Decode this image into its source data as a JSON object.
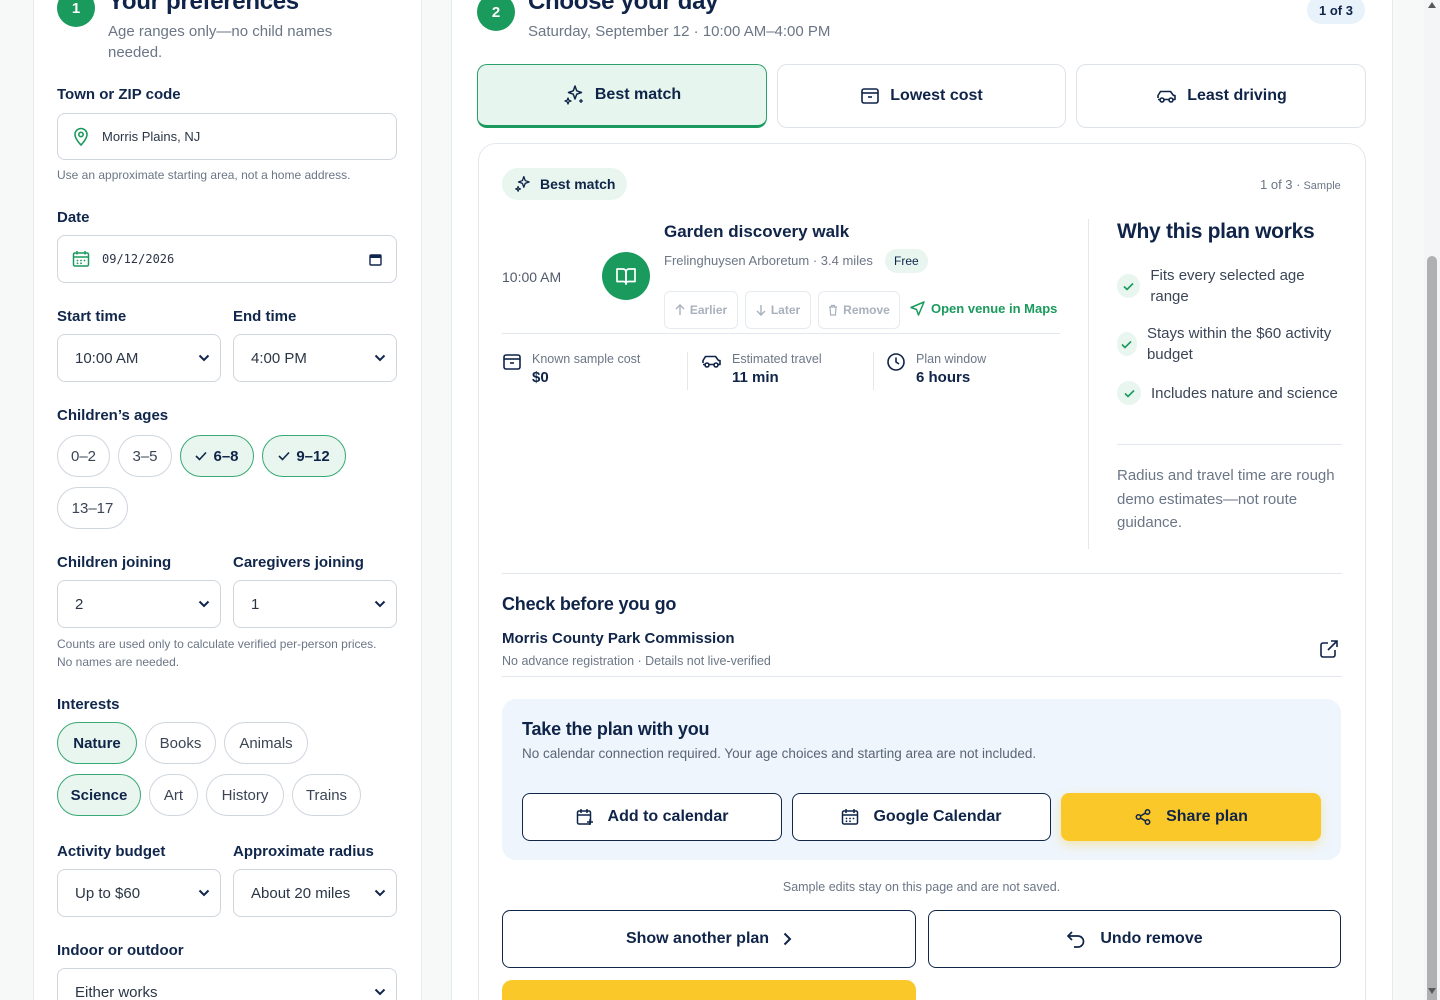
{
  "left": {
    "step_number": "1",
    "title": "Your preferences",
    "subtitle": "Age ranges only—no child names needed.",
    "town_label": "Town or ZIP code",
    "town_value": "Morris Plains, NJ",
    "town_help": "Use an approximate starting area, not a home address.",
    "date_label": "Date",
    "date_value": "09/12/2026",
    "start_label": "Start time",
    "start_value": "10:00 AM",
    "end_label": "End time",
    "end_value": "4:00 PM",
    "ages_label": "Children’s ages",
    "ages": [
      {
        "label": "0–2",
        "selected": false
      },
      {
        "label": "3–5",
        "selected": false
      },
      {
        "label": "6–8",
        "selected": true
      },
      {
        "label": "9–12",
        "selected": true
      },
      {
        "label": "13–17",
        "selected": false
      }
    ],
    "children_label": "Children joining",
    "children_value": "2",
    "caregivers_label": "Caregivers joining",
    "caregivers_value": "1",
    "counts_help": "Counts are used only to calculate verified per-person prices. No names are needed.",
    "interests_label": "Interests",
    "interests": [
      {
        "label": "Nature",
        "selected": true
      },
      {
        "label": "Books",
        "selected": false
      },
      {
        "label": "Animals",
        "selected": false
      },
      {
        "label": "Science",
        "selected": true
      },
      {
        "label": "Art",
        "selected": false
      },
      {
        "label": "History",
        "selected": false
      },
      {
        "label": "Trains",
        "selected": false
      }
    ],
    "budget_label": "Activity budget",
    "budget_value": "Up to $60",
    "radius_label": "Approximate radius",
    "radius_value": "About 20 miles",
    "indoor_label": "Indoor or outdoor",
    "indoor_value": "Either works"
  },
  "right": {
    "step_number": "2",
    "title": "Choose your day",
    "subtitle": "Saturday, September 12 · 10:00 AM–4:00 PM",
    "badge": "1 of 3",
    "tabs": [
      {
        "label": "Best match",
        "icon": "sparkles-icon",
        "active": true
      },
      {
        "label": "Lowest cost",
        "icon": "wallet-icon",
        "active": false
      },
      {
        "label": "Least driving",
        "icon": "car-icon",
        "active": false
      }
    ],
    "card": {
      "pill": "Best match",
      "count": "1 of 3 ·",
      "sample": "Sample",
      "activity": {
        "time": "10:00 AM",
        "title": "Garden discovery walk",
        "meta": "Frelinghuysen Arboretum · 3.4 miles",
        "badge": "Free",
        "earlier": "Earlier",
        "later": "Later",
        "remove": "Remove",
        "maps": "Open venue in Maps"
      },
      "stats": [
        {
          "label": "Known sample cost",
          "value": "$0"
        },
        {
          "label": "Estimated travel",
          "value": "11 min"
        },
        {
          "label": "Plan window",
          "value": "6 hours"
        }
      ],
      "why_title": "Why this plan works",
      "why_items": [
        "Fits every selected age range",
        "Stays within the $60 activity budget",
        "Includes nature and science"
      ],
      "why_note": "Radius and travel time are rough demo estimates—not route guidance.",
      "check_title": "Check before you go",
      "org_name": "Morris County Park Commission",
      "org_meta": "No advance registration · Details not live-verified",
      "take_title": "Take the plan with you",
      "take_sub": "No calendar connection required. Your age choices and starting area are not included.",
      "add_calendar": "Add to calendar",
      "google_calendar": "Google Calendar",
      "share": "Share plan",
      "edits_note": "Sample edits stay on this page and are not saved.",
      "another": "Show another plan",
      "undo": "Undo remove"
    }
  },
  "colors": {
    "accent": "#1b9a5d",
    "navy": "#0f2448",
    "yellow": "#fbc829",
    "pill_bg": "#e8f6ef"
  }
}
